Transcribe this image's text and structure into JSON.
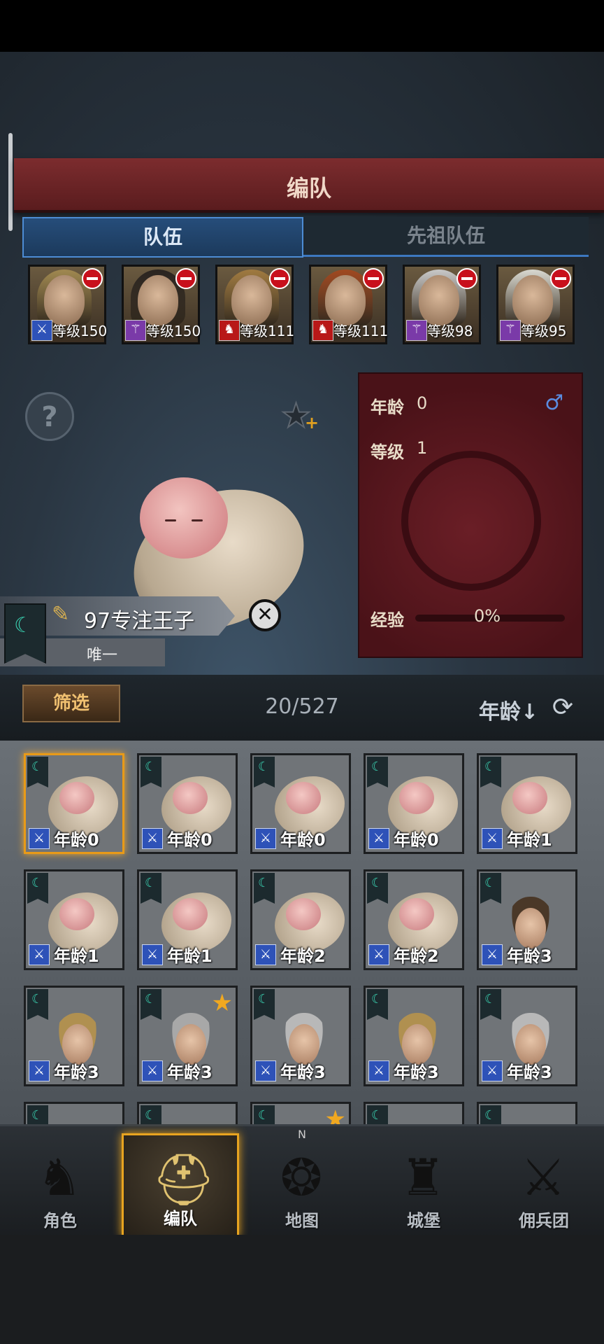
{
  "header": {
    "title": "编队"
  },
  "tabs": [
    {
      "label": "队伍",
      "active": true
    },
    {
      "label": "先祖队伍",
      "active": false
    }
  ],
  "team": [
    {
      "level": "等级150",
      "class_icon": "sword-icon",
      "class_color": "#2e52b8",
      "hair": "#a08850"
    },
    {
      "level": "等级150",
      "class_icon": "staff-icon",
      "class_color": "#7a3aa8",
      "hair": "#2a2420"
    },
    {
      "level": "等级111",
      "class_icon": "horse-icon",
      "class_color": "#b81818",
      "hair": "#a07a40"
    },
    {
      "level": "等级111",
      "class_icon": "horse-icon",
      "class_color": "#b81818",
      "hair": "#a04820"
    },
    {
      "level": "等级98",
      "class_icon": "staff-icon",
      "class_color": "#7a3aa8",
      "hair": "#c8c8c8"
    },
    {
      "level": "等级95",
      "class_icon": "staff-icon",
      "class_color": "#7a3aa8",
      "hair": "#d8d8d0"
    }
  ],
  "character": {
    "name": "97专注王子",
    "rarity": "唯一",
    "age_label": "年龄",
    "age_value": "0",
    "level_label": "等级",
    "level_value": "1",
    "gender_symbol": "♂",
    "exp_label": "经验",
    "exp_value": "0%",
    "exp_fraction": 0
  },
  "help_symbol": "?",
  "close_symbol": "✕",
  "filter": {
    "button": "筛选",
    "count": "20/527",
    "sort": "年龄↓",
    "refresh_symbol": "⟳"
  },
  "grid": [
    {
      "age": "年龄0",
      "type": "baby",
      "selected": true,
      "star": false
    },
    {
      "age": "年龄0",
      "type": "baby",
      "selected": false,
      "star": false
    },
    {
      "age": "年龄0",
      "type": "baby",
      "selected": false,
      "star": false
    },
    {
      "age": "年龄0",
      "type": "baby",
      "selected": false,
      "star": false
    },
    {
      "age": "年龄1",
      "type": "baby",
      "selected": false,
      "star": false
    },
    {
      "age": "年龄1",
      "type": "baby",
      "selected": false,
      "star": false
    },
    {
      "age": "年龄1",
      "type": "baby",
      "selected": false,
      "star": false
    },
    {
      "age": "年龄2",
      "type": "baby",
      "selected": false,
      "star": false
    },
    {
      "age": "年龄2",
      "type": "baby",
      "selected": false,
      "star": false
    },
    {
      "age": "年龄3",
      "type": "child",
      "hair": "#4a3828",
      "selected": false,
      "star": false
    },
    {
      "age": "年龄3",
      "type": "child",
      "hair": "#b09050",
      "selected": false,
      "star": false
    },
    {
      "age": "年龄3",
      "type": "child",
      "hair": "#a8a8a8",
      "selected": false,
      "star": true
    },
    {
      "age": "年龄3",
      "type": "child",
      "hair": "#b8b8b8",
      "selected": false,
      "star": false
    },
    {
      "age": "年龄3",
      "type": "child",
      "hair": "#b09050",
      "selected": false,
      "star": false
    },
    {
      "age": "年龄3",
      "type": "child",
      "hair": "#b8b8b8",
      "selected": false,
      "star": false
    },
    {
      "age": "",
      "type": "partial",
      "selected": false,
      "star": false
    },
    {
      "age": "",
      "type": "partial",
      "selected": false,
      "star": false
    },
    {
      "age": "",
      "type": "partial",
      "selected": false,
      "star": true
    },
    {
      "age": "",
      "type": "partial",
      "selected": false,
      "star": false
    },
    {
      "age": "",
      "type": "partial",
      "selected": false,
      "star": false
    }
  ],
  "nav": [
    {
      "label": "角色",
      "icon": "knight-icon",
      "active": false
    },
    {
      "label": "编队",
      "icon": "helmet-icon",
      "active": true
    },
    {
      "label": "地图",
      "icon": "compass-map-icon",
      "active": false
    },
    {
      "label": "城堡",
      "icon": "castle-icon",
      "active": false
    },
    {
      "label": "佣兵团",
      "icon": "mercenary-icon",
      "active": false
    }
  ],
  "compass_letter": "N",
  "colors": {
    "accent": "#e8a420",
    "tab_blue": "#4d8cd4",
    "banner_red": "#7c2c2e",
    "panel_red": "#5a1820"
  }
}
